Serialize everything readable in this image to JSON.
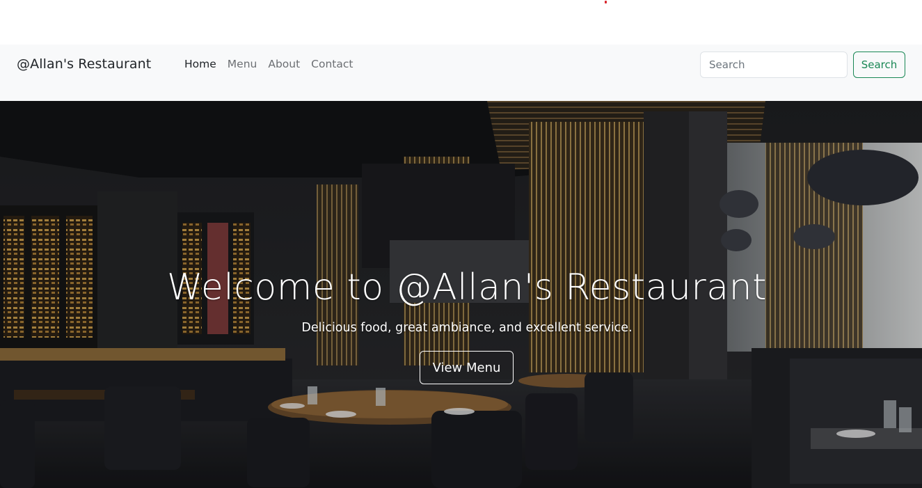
{
  "navbar": {
    "brand": "@Allan's Restaurant",
    "links": [
      {
        "label": "Home",
        "active": true
      },
      {
        "label": "Menu",
        "active": false
      },
      {
        "label": "About",
        "active": false
      },
      {
        "label": "Contact",
        "active": false
      }
    ],
    "search": {
      "placeholder": "Search",
      "value": "",
      "button_label": "Search"
    }
  },
  "hero": {
    "title": "Welcome to @Allan's Restaurant",
    "subtitle": "Delicious food, great ambiance, and excellent service.",
    "button_label": "View Menu",
    "background_image": "restaurant-interior-photo"
  },
  "colors": {
    "navbar_bg": "#f8f9fa",
    "search_button": "#198754",
    "hero_text": "#ffffff"
  }
}
